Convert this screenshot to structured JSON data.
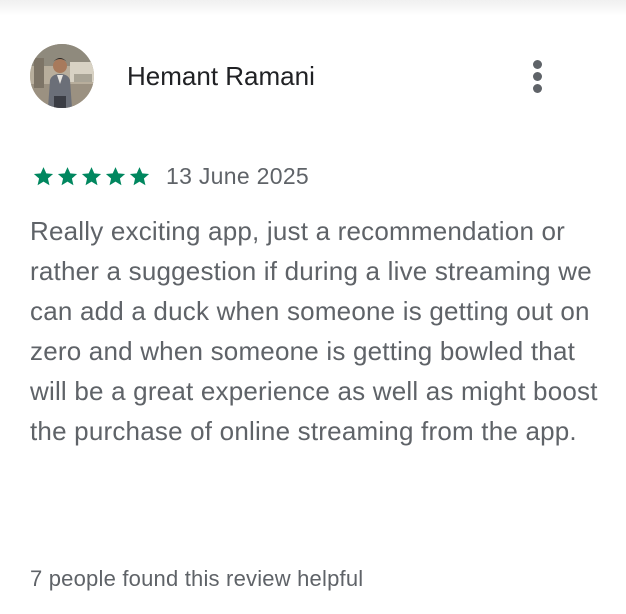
{
  "review": {
    "reviewer_name": "Hemant Ramani",
    "avatar_icon": "user-avatar-photo",
    "more_icon": "more-vert-icon",
    "rating": 5,
    "rating_max": 5,
    "star_color": "#01875f",
    "date": "13 June 2025",
    "text": "Really exciting app, just a recommendation or rather a suggestion if during a live streaming we can add a duck when someone is getting out on zero and when someone is getting bowled that will be a great experience as well as might boost the purchase of online streaming from the app.",
    "helpful_text": "7 people found this review helpful"
  }
}
